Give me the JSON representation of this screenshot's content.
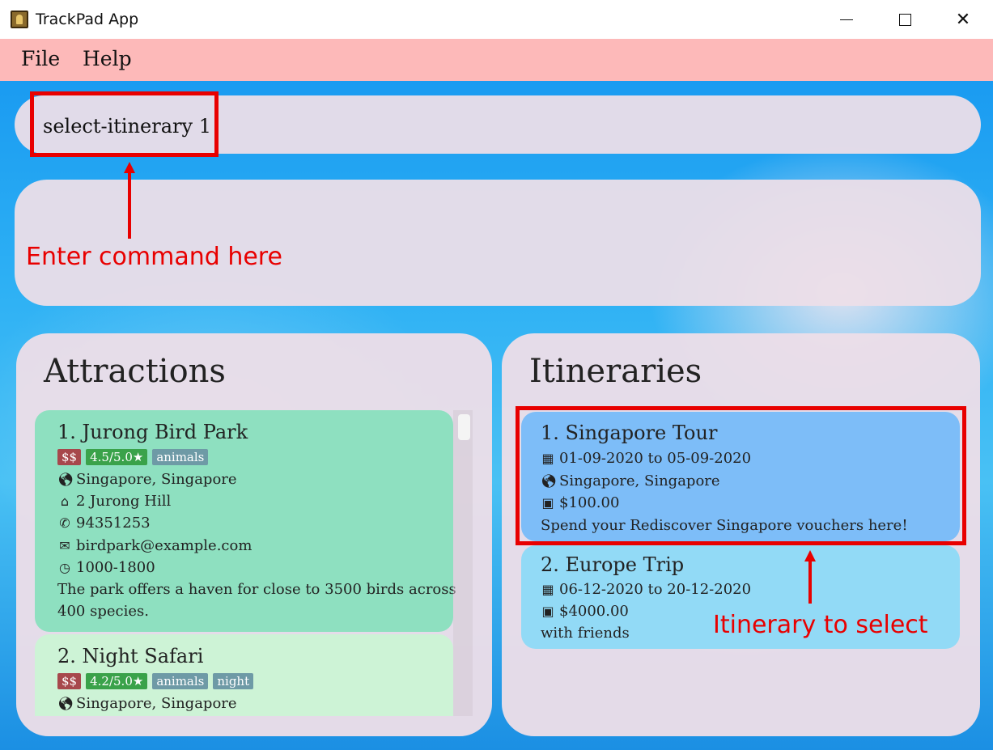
{
  "window": {
    "title": "TrackPad App"
  },
  "menu": {
    "file": "File",
    "help": "Help"
  },
  "command": {
    "value": "select-itinerary 1"
  },
  "panels": {
    "attractions_title": "Attractions",
    "itineraries_title": "Itineraries"
  },
  "attractions": [
    {
      "name": "1.  Jurong Bird Park",
      "price": "$$",
      "rating": "4.5/5.0★",
      "tags": [
        "animals"
      ],
      "location": "Singapore, Singapore",
      "address": "2 Jurong Hill",
      "phone": "94351253",
      "email": "birdpark@example.com",
      "hours": "1000-1800",
      "description_line1": "The park offers a haven for close to 3500 birds across",
      "description_line2": "400 species.",
      "color": "#8ee0c0"
    },
    {
      "name": "2.  Night Safari",
      "price": "$$",
      "rating": "4.2/5.0★",
      "tags": [
        "animals",
        "night"
      ],
      "location": "Singapore, Singapore",
      "color": "#cdf3d6"
    }
  ],
  "itineraries": [
    {
      "name": "1.  Singapore Tour",
      "dates": "01-09-2020 to 05-09-2020",
      "location": "Singapore, Singapore",
      "budget": "$100.00",
      "description": "Spend your Rediscover Singapore vouchers here!",
      "color": "#7dbdf8"
    },
    {
      "name": "2.  Europe Trip",
      "dates": "06-12-2020 to 20-12-2020",
      "budget": "$4000.00",
      "description": "with friends",
      "color": "#92daf6"
    }
  ],
  "annotations": {
    "command_hint": "Enter command here",
    "itinerary_hint": "Itinerary to select",
    "color": "#e80000"
  },
  "icons": {
    "calendar": "calendar-icon",
    "globe": "globe-icon",
    "money": "money-icon",
    "home": "home-icon",
    "phone": "phone-icon",
    "email": "email-icon",
    "clock": "clock-icon"
  }
}
